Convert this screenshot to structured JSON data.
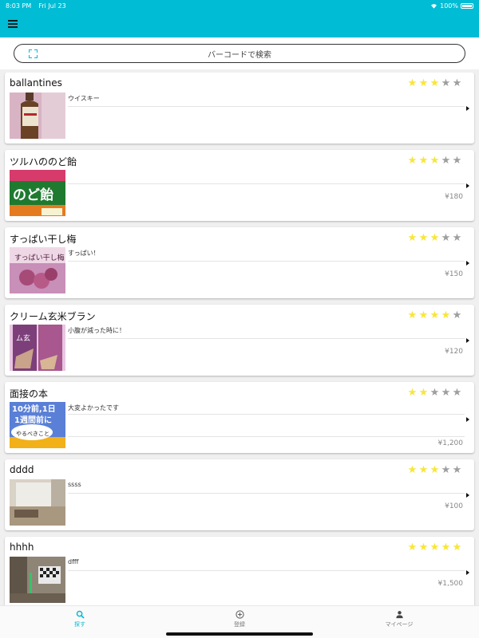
{
  "status": {
    "time": "8:03 PM",
    "date": "Fri Jul 23",
    "battery": "100%"
  },
  "search": {
    "label": "バーコードで検索"
  },
  "items": [
    {
      "title": "ballantines",
      "rating": 3,
      "comment": "ウイスキー",
      "price": ""
    },
    {
      "title": "ツルハののど飴",
      "rating": 3,
      "comment": "",
      "price": "¥180"
    },
    {
      "title": "すっぱい干し梅",
      "rating": 3,
      "comment": "すっぱい！",
      "price": "¥150"
    },
    {
      "title": "クリーム玄米ブラン",
      "rating": 4,
      "comment": "小腹が減った時に！",
      "price": "¥120"
    },
    {
      "title": "面接の本",
      "rating": 2,
      "comment": "大変よかったです",
      "price": "¥1,200"
    },
    {
      "title": "dddd",
      "rating": 3,
      "comment": "ssss",
      "price": "¥100"
    },
    {
      "title": "hhhh",
      "rating": 5,
      "comment": "dfff",
      "price": "¥1,500"
    }
  ],
  "thumb_images": {
    "0": "ballantines-bottle",
    "1": "nodoame-package",
    "2": "hoshiume-package",
    "3": "genmai-bran-package",
    "4": "mensetsu-book-cover",
    "5": "room-photo",
    "6": "room-tv-photo"
  },
  "colors": {
    "accent": "#00bcd4",
    "star_on": "#f7e63a",
    "star_off": "#9e9e9e"
  },
  "nav": {
    "items": [
      {
        "label": "探す",
        "icon": "search-icon",
        "active": true
      },
      {
        "label": "登録",
        "icon": "add-circle-icon",
        "active": false
      },
      {
        "label": "マイページ",
        "icon": "person-icon",
        "active": false
      }
    ]
  }
}
